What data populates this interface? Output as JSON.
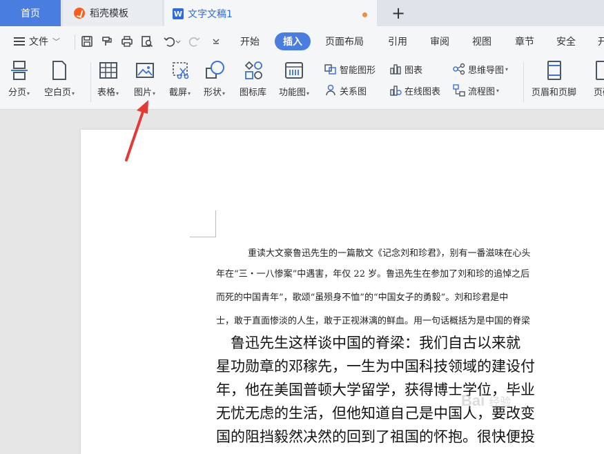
{
  "tabs": {
    "home": "首页",
    "daoke": "稻壳模板",
    "document": "文字文稿1",
    "new_tab": "+"
  },
  "menu": {
    "file": "文件",
    "items": [
      "开始",
      "插入",
      "页面布局",
      "引用",
      "审阅",
      "视图",
      "章节",
      "安全",
      "开"
    ],
    "active": "插入"
  },
  "ribbon": {
    "page_break": "分页",
    "blank_page": "空白页",
    "table": "表格",
    "picture": "图片",
    "screenshot": "截屏",
    "shape": "形状",
    "icon_library": "图标库",
    "function_chart": "功能图",
    "smart_graphic": "智能图形",
    "chart": "图表",
    "relation_chart": "关系图",
    "online_chart": "在线图表",
    "mind_map": "思维导图",
    "flowchart": "流程图",
    "header_footer": "页眉和页脚",
    "page_number_partial": "页码"
  },
  "document": {
    "small_lines": [
      "重读大文豪鲁迅先生的一篇散文《记念刘和珍君》，别有一番滋味在心头",
      "年在“三・一八惨案”中遇害，年仅 22 岁。鲁迅先生在参加了刘和珍的追悼之后",
      "而死的中国青年”，歌颂“虽殒身不恤”的“中国女子的勇毅”。刘和珍君是中",
      "士，敢于直面惨淡的人生，敢于正视淋漓的鲜血。用一句话概括为是中国的脊梁"
    ],
    "big_lines": [
      "　鲁迅先生这样谈中国的脊梁：我们自古以来就",
      "星功勋章的邓稼先，一生为中国科技领域的建设付",
      "年，他在美国普顿大学留学，获得博士学位，毕业",
      "无忧无虑的生活，但他知道自己是中国人，要改变",
      "国的阻挡毅然决然的回到了祖国的怀抱。很快便投"
    ]
  },
  "watermark": {
    "text": "Bai",
    "sub": "经验"
  },
  "colors": {
    "accent": "#4a7de0",
    "arrow": "#e53935"
  }
}
